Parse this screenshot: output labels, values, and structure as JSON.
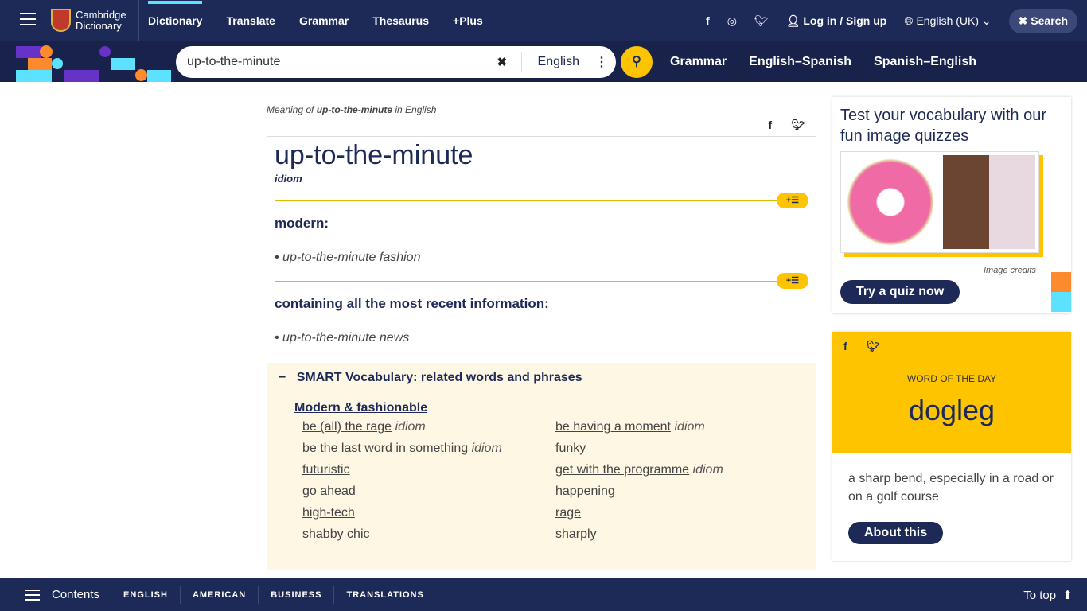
{
  "header": {
    "logo": "Cambridge Dictionary",
    "nav": [
      "Dictionary",
      "Translate",
      "Grammar",
      "Thesaurus",
      "+Plus"
    ],
    "login": "Log in / Sign up",
    "language": "English (UK)",
    "search_label": "Search"
  },
  "searchbar": {
    "value": "up-to-the-minute",
    "dataset": "English",
    "links": [
      "Grammar",
      "English–Spanish",
      "Spanish–English"
    ]
  },
  "entry": {
    "meaning_prefix": "Meaning of ",
    "meaning_word": "up-to-the-minute",
    "meaning_suffix": " in English",
    "headword": "up-to-the-minute",
    "pos": "idiom",
    "senses": [
      {
        "definition": "modern:",
        "example": "up-to-the-minute fashion"
      },
      {
        "definition": "containing all the most recent information:",
        "example": "up-to-the-minute news"
      }
    ]
  },
  "smart": {
    "title": "SMART Vocabulary: related words and phrases",
    "category": "Modern & fashionable",
    "items": [
      {
        "w": "be (all) the rage",
        "t": "idiom"
      },
      {
        "w": "be having a moment",
        "t": "idiom"
      },
      {
        "w": "be the last word in something",
        "t": "idiom"
      },
      {
        "w": "funky",
        "t": ""
      },
      {
        "w": "futuristic",
        "t": ""
      },
      {
        "w": "get with the programme",
        "t": "idiom"
      },
      {
        "w": "go ahead",
        "t": ""
      },
      {
        "w": "happening",
        "t": ""
      },
      {
        "w": "high-tech",
        "t": ""
      },
      {
        "w": "rage",
        "t": ""
      },
      {
        "w": "shabby chic",
        "t": ""
      },
      {
        "w": "sharply",
        "t": ""
      }
    ]
  },
  "quiz": {
    "title": "Test your vocabulary with our fun image quizzes",
    "credits": "Image credits",
    "button": "Try a quiz now"
  },
  "wotd": {
    "label": "WORD OF THE DAY",
    "word": "dogleg",
    "definition": "a sharp bend, especially in a road or on a golf course",
    "button": "About this"
  },
  "footer": {
    "contents": "Contents",
    "links": [
      "ENGLISH",
      "AMERICAN",
      "BUSINESS",
      "TRANSLATIONS"
    ],
    "to_top": "To top"
  },
  "colors": {
    "navy": "#1d2a57",
    "yellow": "#fec400",
    "cyan": "#5ce1ff",
    "orange": "#fe8a2e",
    "purple": "#6732c8"
  }
}
